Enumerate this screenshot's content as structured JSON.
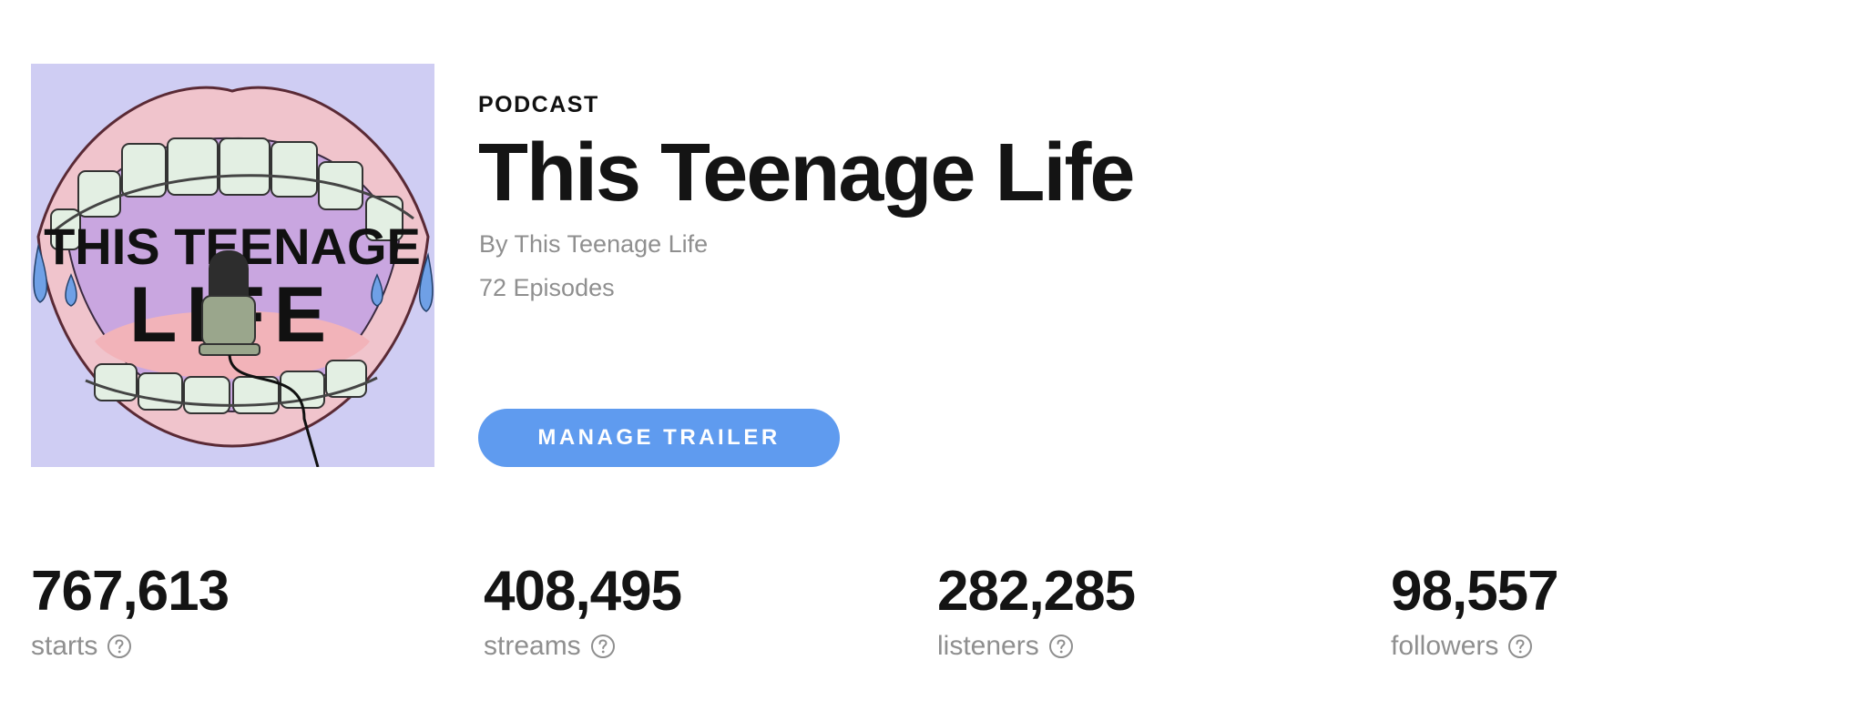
{
  "podcast": {
    "kind_label": "PODCAST",
    "title": "This Teenage Life",
    "byline": "By This Teenage Life",
    "episodes": "72 Episodes",
    "cover_text_line1": "THIS TEENAGE",
    "cover_text_line2": "LIFE"
  },
  "actions": {
    "manage_trailer_label": "MANAGE TRAILER"
  },
  "stats": [
    {
      "value": "767,613",
      "label": "starts",
      "icon": "help-circle-icon"
    },
    {
      "value": "408,495",
      "label": "streams",
      "icon": "help-circle-icon"
    },
    {
      "value": "282,285",
      "label": "listeners",
      "icon": "help-circle-icon"
    },
    {
      "value": "98,557",
      "label": "followers",
      "icon": "help-circle-icon"
    }
  ],
  "colors": {
    "button_bg": "#5f9bef",
    "cover_bg": "#cfcdf3",
    "muted_text": "#8f8f8f",
    "primary_text": "#141414"
  }
}
